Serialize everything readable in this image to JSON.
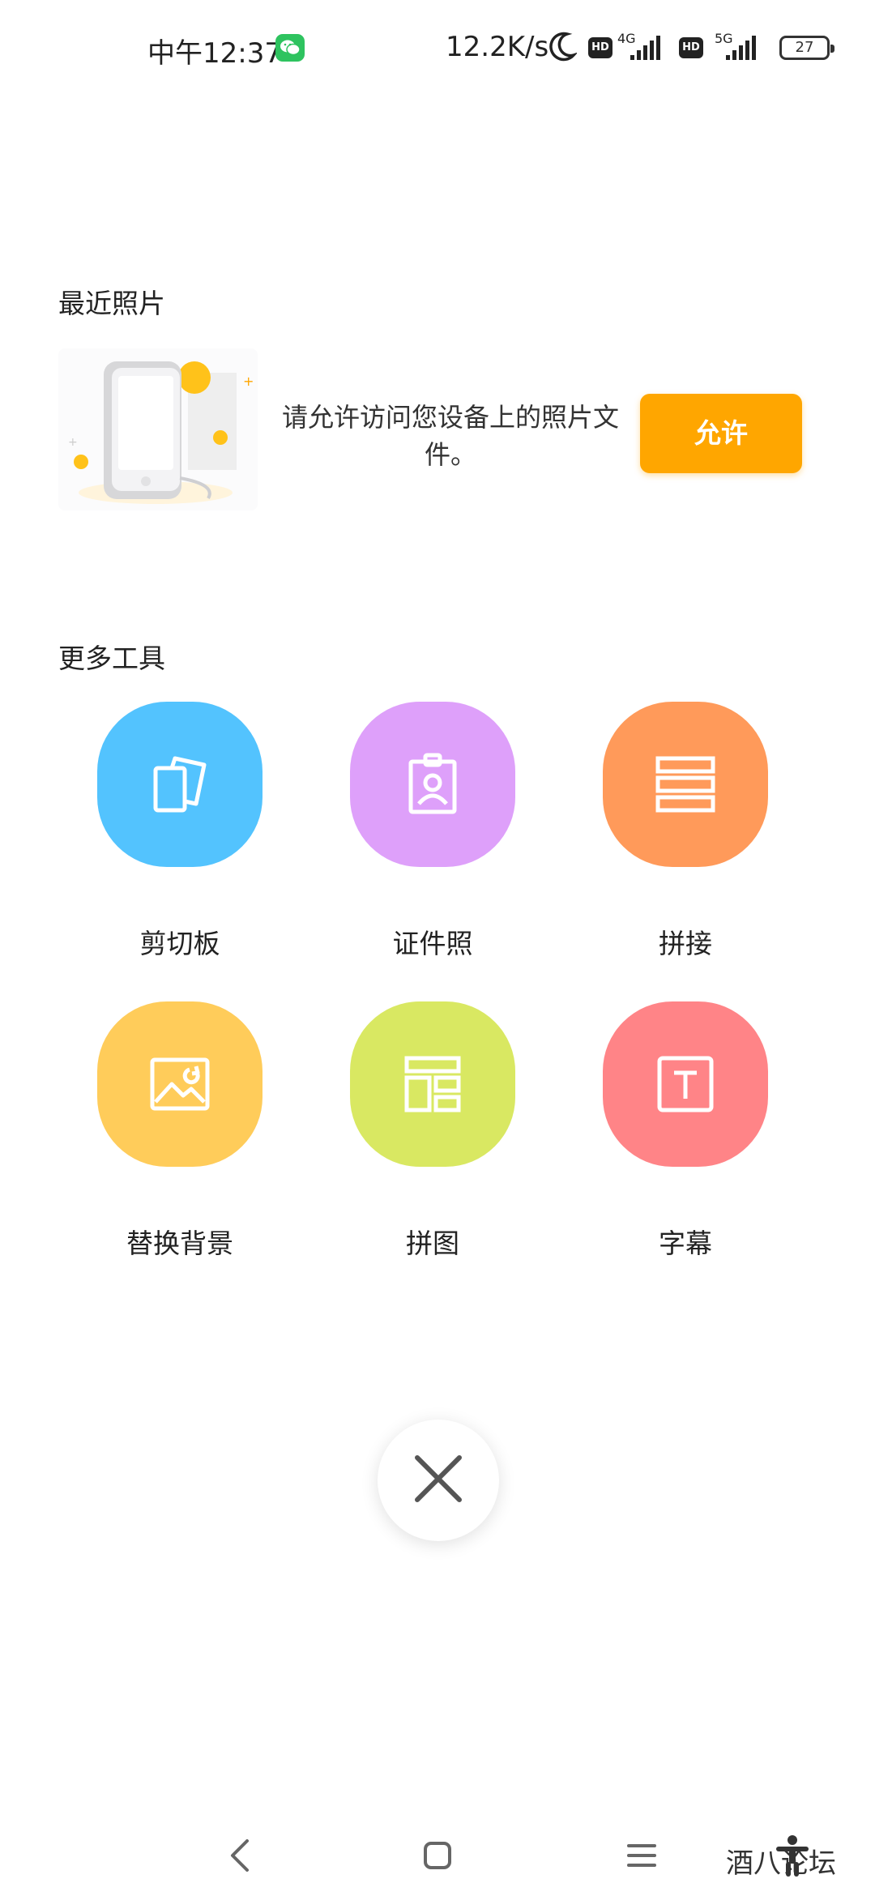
{
  "status_bar": {
    "time": "中午12:37",
    "net_speed": "12.2K/s",
    "hd_badge": "HD",
    "net_4g": "4G",
    "net_5g": "5G",
    "battery": "27"
  },
  "recent_photos": {
    "title": "最近照片",
    "permission_text": "请允许访问您设备上的照片文件。",
    "allow_label": "允许"
  },
  "more_tools": {
    "title": "更多工具",
    "tools": [
      {
        "label": "剪切板",
        "icon": "clipboard-icon",
        "color": "#53c3fe"
      },
      {
        "label": "证件照",
        "icon": "id-photo-icon",
        "color": "#dea0fa"
      },
      {
        "label": "拼接",
        "icon": "stitch-icon",
        "color": "#ff9a5a"
      },
      {
        "label": "替换背景",
        "icon": "replace-background-icon",
        "color": "#ffcc5a"
      },
      {
        "label": "拼图",
        "icon": "collage-icon",
        "color": "#d9e862"
      },
      {
        "label": "字幕",
        "icon": "subtitle-icon",
        "color": "#ff8487"
      }
    ]
  },
  "close": {
    "icon": "close-icon"
  },
  "nav_bar": {
    "back": "back-icon",
    "home": "home-icon",
    "recents": "menu-icon",
    "accessibility": "accessibility-icon"
  },
  "watermark": "酒八论坛"
}
